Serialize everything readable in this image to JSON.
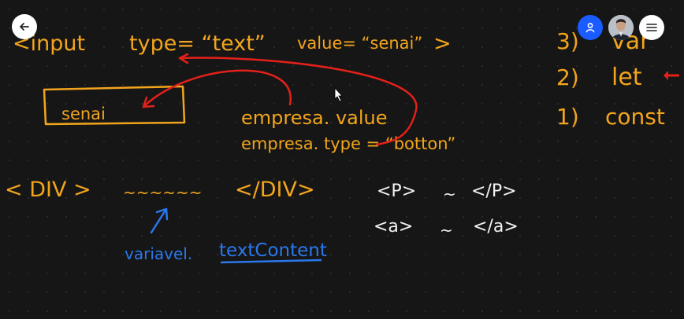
{
  "toolbar": {
    "back_icon": "arrow-left-icon",
    "share_icon": "person-icon",
    "menu_icon": "hamburger-icon",
    "accent": "#1a5cff"
  },
  "board": {
    "ink_colors": {
      "orange": "#f2a51c",
      "red": "#e3211a",
      "white": "#f3f3f3",
      "blue": "#2a78ee"
    },
    "input_line": {
      "tag_open": "<input",
      "type_attr": "type= “text”",
      "value_attr": "value= “senai”",
      "tag_close": ">"
    },
    "box_text": "senai",
    "empresa_value": "empresa. value",
    "empresa_type": "empresa. type = “botton”",
    "div_open": "< DIV >",
    "div_wave": "~~~~~~",
    "div_close": "</DIV>",
    "p_open": "<P>",
    "p_wave": "~",
    "p_close": "</P>",
    "a_open": "<a>",
    "a_wave": "~",
    "a_close": "</a>",
    "blue_prefix": "variavel.",
    "blue_prop": "textContent",
    "list": [
      {
        "num": "3)",
        "word": "var"
      },
      {
        "num": "2)",
        "word": "let"
      },
      {
        "num": "1)",
        "word": "const"
      }
    ]
  }
}
